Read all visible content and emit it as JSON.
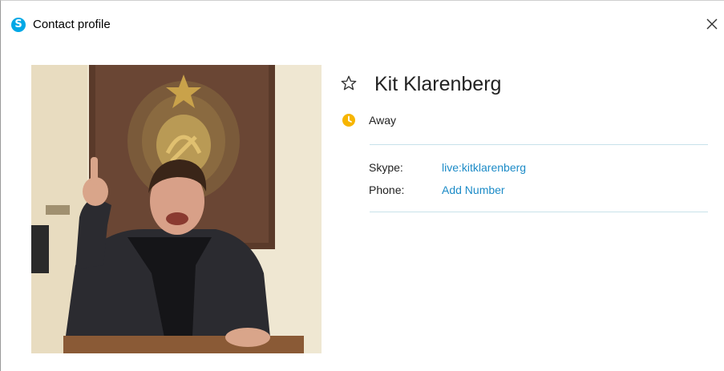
{
  "window": {
    "title": "Contact profile",
    "app_icon_glyph": "S",
    "app_icon": "skype-icon",
    "close_icon": "close-icon"
  },
  "contact": {
    "name": "Kit Klarenberg",
    "favorite_icon": "star-outline-icon",
    "status": "Away",
    "status_icon": "away-clock-icon",
    "status_color": "#f7b500",
    "details": [
      {
        "label": "Skype:",
        "value": "live:kitklarenberg"
      },
      {
        "label": "Phone:",
        "value": "Add Number"
      }
    ]
  },
  "colors": {
    "link": "#1c8bc7",
    "divider": "#c8e2ea",
    "brand": "#00a8e6"
  }
}
